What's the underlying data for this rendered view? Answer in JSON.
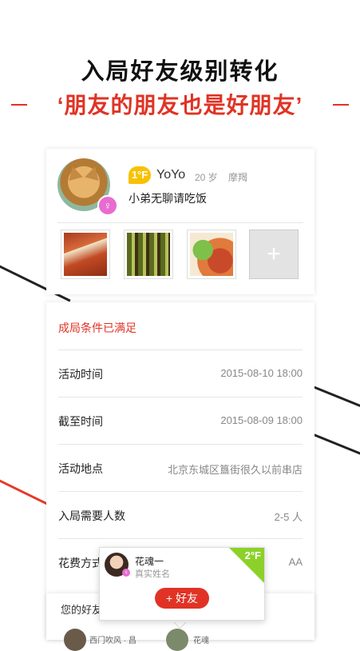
{
  "header": {
    "headline": "入局好友级别转化",
    "subline": "‘朋友的朋友也是好朋友’"
  },
  "profile": {
    "floor_badge": "1°F",
    "name": "YoYo",
    "age": "20 岁",
    "zodiac": "摩羯",
    "message": "小弟无聊请吃饭",
    "gender_symbol": "♀",
    "add_symbol": "+"
  },
  "details": {
    "condition": "成局条件已满足",
    "rows": [
      {
        "label": "活动时间",
        "value": "2015-08-10 18:00"
      },
      {
        "label": "截至时间",
        "value": "2015-08-09 18:00"
      },
      {
        "label": "活动地点",
        "value": "北京东城区簋街很久以前串店"
      },
      {
        "label": "入局需要人数",
        "value": "2-5 人"
      },
      {
        "label": "花费方式",
        "value": "AA"
      }
    ]
  },
  "friends": {
    "title": "您的好友已有2位",
    "items": [
      {
        "name": "西门吹风 · 昌"
      },
      {
        "name": "花魂"
      }
    ]
  },
  "popup": {
    "name": "花魂一",
    "subtitle": "真实姓名",
    "floor": "2°F",
    "button": "+ 好友"
  }
}
